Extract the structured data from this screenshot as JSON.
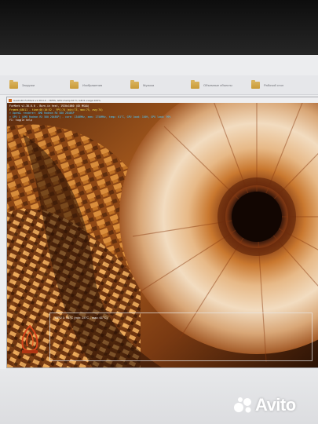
{
  "nav": {
    "items": [
      {
        "label": "Загрузки",
        "icon": "folder-icon"
      },
      {
        "label": "Изображения",
        "icon": "folder-icon"
      },
      {
        "label": "Музыка",
        "icon": "folder-icon"
      },
      {
        "label": "Объемные объекты",
        "icon": "folder-icon"
      },
      {
        "label": "Рабочий стол",
        "icon": "folder-icon"
      }
    ]
  },
  "window": {
    "title": "Geeks3D FurMark v1.38.0.0 - 74FPS, GPU1 temp:61°C, GPU1 usage:100%"
  },
  "overlay": {
    "line1": "FurMark v1.38.0.0 - Burn-in test, 1920x1080 (8X MSAA)",
    "line2": "Frames:48011 - time:00:10:52 - FPS:74 (min:73, max:75, avg:74)",
    "line3": "> OpenGL renderer: AMD Radeon RX 580 2048SP",
    "line4": "> GPU 1 (AMD Radeon RX 580 2048SP) - core: 1340MHz, mem: 1750MHz, temp: 61°C, GPU load: 100%, GPU load: 99%",
    "line5": "F1: toggle help",
    "color_title": "#ffffff",
    "color_info": "#f2e24a",
    "color_gpu": "#49c8ff"
  },
  "gpu_graph": {
    "label": "GPU 1: 61°C (min: 24°C - max: 61°C)"
  },
  "watermark": {
    "brand": "Avito"
  }
}
